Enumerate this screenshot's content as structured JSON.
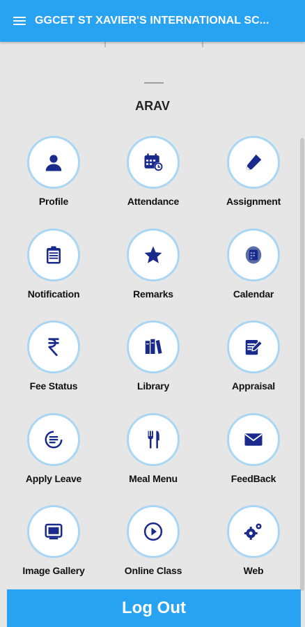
{
  "appbar": {
    "title": "GGCET ST XAVIER'S INTERNATIONAL SC...",
    "color": "#27a3f2"
  },
  "student": {
    "name": "ARAV"
  },
  "tiles": [
    {
      "label": "Profile",
      "icon": "person-icon"
    },
    {
      "label": "Attendance",
      "icon": "calendar-clock-icon"
    },
    {
      "label": "Assignment",
      "icon": "pencil-icon"
    },
    {
      "label": "Notification",
      "icon": "clipboard-icon"
    },
    {
      "label": "Remarks",
      "icon": "star-icon"
    },
    {
      "label": "Calendar",
      "icon": "calendar-icon"
    },
    {
      "label": "Fee Status",
      "icon": "rupee-icon"
    },
    {
      "label": "Library",
      "icon": "books-icon"
    },
    {
      "label": "Appraisal",
      "icon": "edit-document-icon"
    },
    {
      "label": "Apply Leave",
      "icon": "leave-form-icon"
    },
    {
      "label": "Meal Menu",
      "icon": "cutlery-icon"
    },
    {
      "label": "FeedBack",
      "icon": "mail-icon"
    },
    {
      "label": "Image Gallery",
      "icon": "gallery-icon"
    },
    {
      "label": "Online Class",
      "icon": "play-icon"
    },
    {
      "label": "Web",
      "icon": "gears-icon"
    }
  ],
  "icon_color": "#1a2a8c",
  "logout": {
    "label": "Log Out"
  }
}
